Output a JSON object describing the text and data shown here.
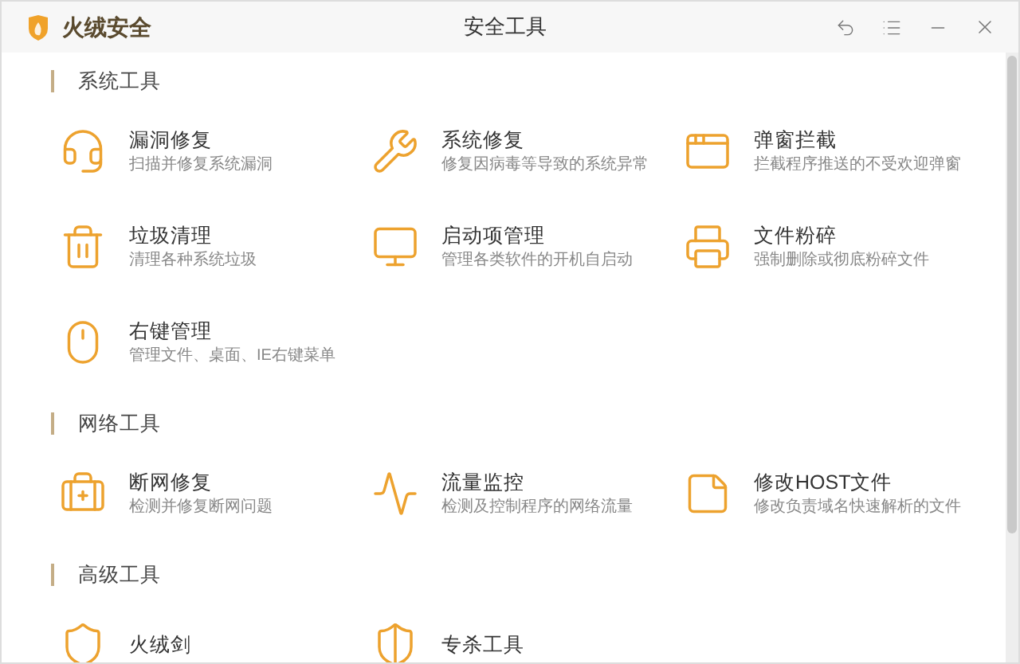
{
  "window": {
    "app_name": "火绒安全",
    "title": "安全工具"
  },
  "sections": [
    {
      "title": "系统工具",
      "items": [
        {
          "title": "漏洞修复",
          "description": "扫描并修复系统漏洞"
        },
        {
          "title": "系统修复",
          "description": "修复因病毒等导致的系统异常"
        },
        {
          "title": "弹窗拦截",
          "description": "拦截程序推送的不受欢迎弹窗"
        },
        {
          "title": "垃圾清理",
          "description": "清理各种系统垃圾"
        },
        {
          "title": "启动项管理",
          "description": "管理各类软件的开机自启动"
        },
        {
          "title": "文件粉碎",
          "description": "强制删除或彻底粉碎文件"
        },
        {
          "title": "右键管理",
          "description": "管理文件、桌面、IE右键菜单"
        }
      ]
    },
    {
      "title": "网络工具",
      "items": [
        {
          "title": "断网修复",
          "description": "检测并修复断网问题"
        },
        {
          "title": "流量监控",
          "description": "检测及控制程序的网络流量"
        },
        {
          "title": "修改HOST文件",
          "description": "修改负责域名快速解析的文件"
        }
      ]
    },
    {
      "title": "高级工具",
      "items": [
        {
          "title": "火绒剑"
        },
        {
          "title": "专杀工具"
        }
      ]
    }
  ]
}
